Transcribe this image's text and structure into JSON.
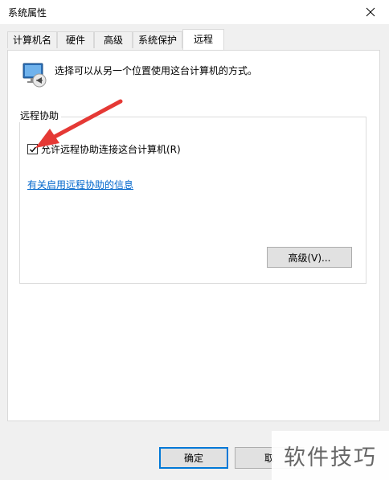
{
  "window": {
    "title": "系统属性"
  },
  "tabs": [
    {
      "label": "计算机名"
    },
    {
      "label": "硬件"
    },
    {
      "label": "高级"
    },
    {
      "label": "系统保护"
    },
    {
      "label": "远程"
    }
  ],
  "active_tab": "远程",
  "header": {
    "text": "选择可以从另一个位置使用这台计算机的方式。",
    "icon": "remote-desktop-icon"
  },
  "remote_assistance": {
    "group_label": "远程协助",
    "checkbox_label": "允许远程协助连接这台计算机(R)",
    "checkbox_checked": true,
    "info_link": "有关启用远程协助的信息",
    "advanced_button": "高级(V)..."
  },
  "buttons": {
    "ok": "确定",
    "cancel": "取"
  },
  "watermark": "软件技巧",
  "annotation": {
    "color": "#e53935"
  },
  "colors": {
    "accent": "#0078d7",
    "link": "#0066cc"
  }
}
